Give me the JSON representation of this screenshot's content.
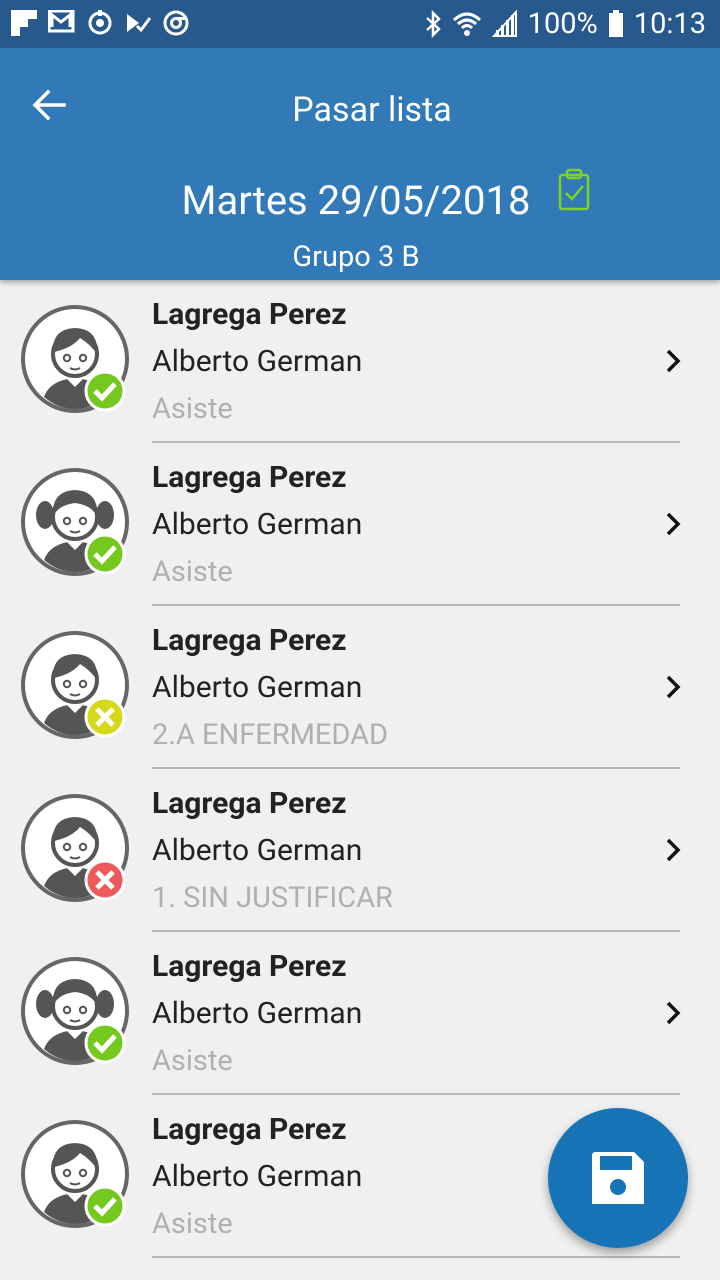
{
  "status_bar": {
    "battery": "100%",
    "time": "10:13"
  },
  "header": {
    "title": "Pasar lista",
    "date": "Martes 29/05/2018",
    "group": "Grupo 3 B"
  },
  "students": [
    {
      "surname": "Lagrega Perez",
      "name": "Alberto German",
      "status": "Asiste",
      "avatar": "boy",
      "badge": "check"
    },
    {
      "surname": "Lagrega Perez",
      "name": "Alberto German",
      "status": "Asiste",
      "avatar": "girl",
      "badge": "check"
    },
    {
      "surname": "Lagrega Perez",
      "name": "Alberto German",
      "status": "2.A  ENFERMEDAD",
      "avatar": "boy",
      "badge": "x-yellow"
    },
    {
      "surname": "Lagrega Perez",
      "name": "Alberto German",
      "status": "1. SIN JUSTIFICAR",
      "avatar": "boy",
      "badge": "x-red"
    },
    {
      "surname": "Lagrega Perez",
      "name": "Alberto German",
      "status": "Asiste",
      "avatar": "girl",
      "badge": "check"
    },
    {
      "surname": "Lagrega Perez",
      "name": "Alberto German",
      "status": "Asiste",
      "avatar": "boy",
      "badge": "check"
    }
  ],
  "colors": {
    "status_bar": "#28598c",
    "app_bar": "#3279b8",
    "fab": "#1573b6",
    "badge_check": "#74c81e",
    "badge_x_yellow": "#d8d81a",
    "badge_x_red": "#ee5a5a"
  }
}
